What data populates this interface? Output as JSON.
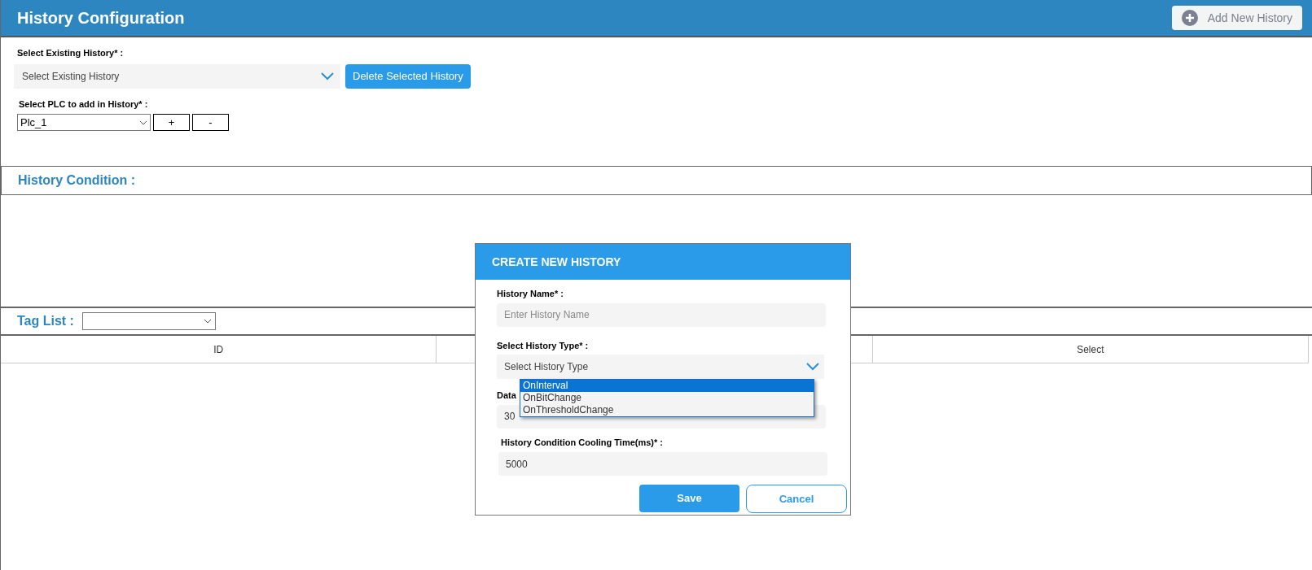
{
  "header": {
    "title": "History Configuration",
    "add_button": "Add New History"
  },
  "existing": {
    "label": "Select Existing History* :",
    "placeholder": "Select Existing History",
    "delete_button": "Delete Selected History"
  },
  "plc": {
    "label": "Select PLC to add in History* :",
    "value": "Plc_1",
    "add": "+",
    "remove": "-"
  },
  "condition": {
    "title": "History Condition :"
  },
  "tag_list": {
    "label": "Tag List :"
  },
  "table": {
    "columns": [
      {
        "label": "ID"
      },
      {
        "label": "Select"
      }
    ]
  },
  "dialog": {
    "title": "CREATE NEW HISTORY",
    "name_label": "History Name* :",
    "name_placeholder": "Enter History Name",
    "type_label": "Select History Type* :",
    "type_placeholder": "Select History Type",
    "options": [
      {
        "label": "OnInterval",
        "selected": true
      },
      {
        "label": "OnBitChange",
        "selected": false
      },
      {
        "label": "OnThresholdChange",
        "selected": false
      }
    ],
    "data_label": "Data",
    "data_value": "30",
    "cooling_label": "History Condition Cooling Time(ms)* :",
    "cooling_value": "5000",
    "save": "Save",
    "cancel": "Cancel"
  }
}
